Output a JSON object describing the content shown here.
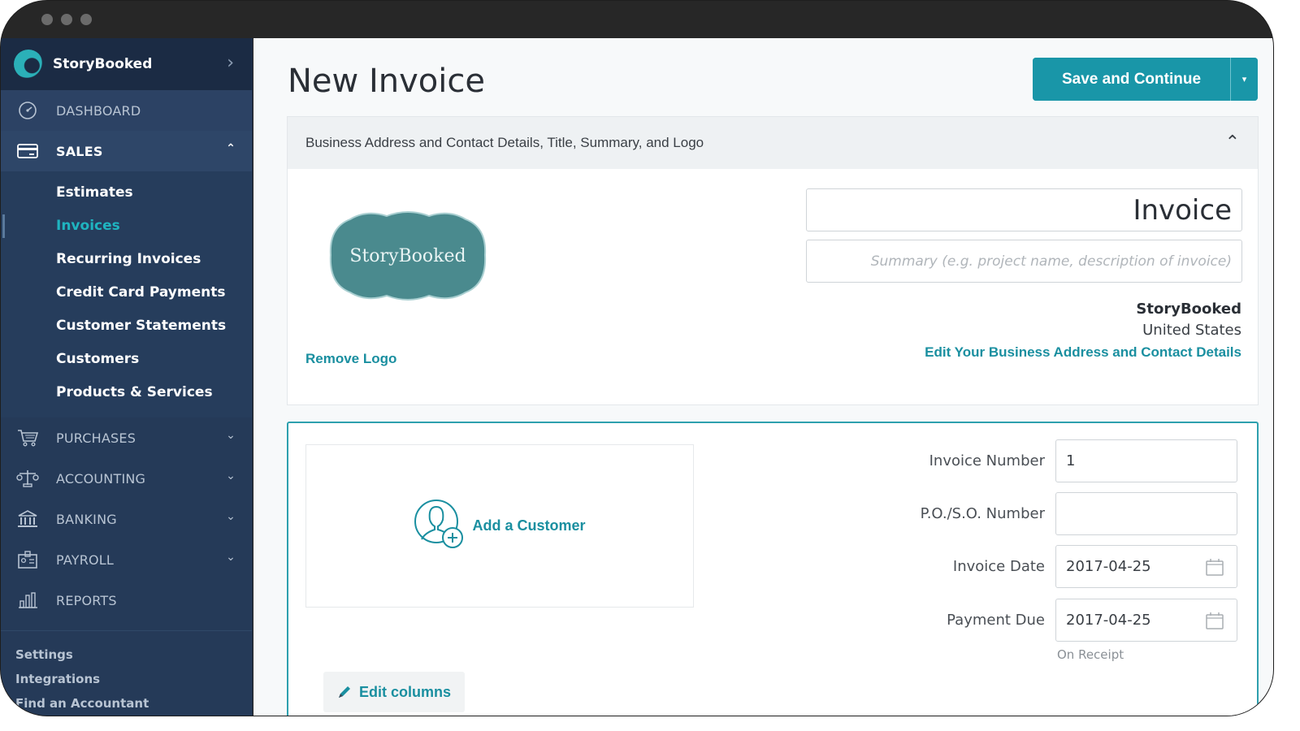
{
  "window": {
    "controls": [
      "close",
      "minimize",
      "maximize"
    ]
  },
  "sidebar": {
    "brand": {
      "name": "StoryBooked",
      "icon": "brand-logo-icon",
      "chevron": "›"
    },
    "nav": [
      {
        "label": "DASHBOARD",
        "icon": "dashboard-gauge-icon",
        "expanded": null
      },
      {
        "label": "SALES",
        "icon": "credit-card-icon",
        "expanded": true,
        "chevron": "^"
      },
      {
        "label": "PURCHASES",
        "icon": "shopping-cart-icon",
        "expanded": false,
        "chevron": "v"
      },
      {
        "label": "ACCOUNTING",
        "icon": "scales-icon",
        "expanded": false,
        "chevron": "v"
      },
      {
        "label": "BANKING",
        "icon": "bank-icon",
        "expanded": false,
        "chevron": "v"
      },
      {
        "label": "PAYROLL",
        "icon": "id-badge-icon",
        "expanded": false,
        "chevron": "v"
      },
      {
        "label": "REPORTS",
        "icon": "bar-chart-icon",
        "expanded": null
      }
    ],
    "sales_items": [
      {
        "label": "Estimates",
        "active": false
      },
      {
        "label": "Invoices",
        "active": true
      },
      {
        "label": "Recurring Invoices",
        "active": false
      },
      {
        "label": "Credit Card Payments",
        "active": false
      },
      {
        "label": "Customer Statements",
        "active": false
      },
      {
        "label": "Customers",
        "active": false
      },
      {
        "label": "Products & Services",
        "active": false
      }
    ],
    "footer": [
      "Settings",
      "Integrations",
      "Find an Accountant"
    ]
  },
  "header": {
    "title": "New Invoice",
    "save_label": "Save and Continue",
    "save_caret": "▾"
  },
  "business_panel": {
    "heading": "Business Address and Contact Details, Title, Summary, and Logo",
    "collapse_glyph": "^",
    "logo_text": "StoryBooked",
    "remove_logo": "Remove Logo",
    "title_value": "Invoice",
    "summary_value": "",
    "summary_placeholder": "Summary (e.g. project name, description of invoice)",
    "business_name": "StoryBooked",
    "business_country": "United States",
    "edit_link": "Edit Your Business Address and Contact Details"
  },
  "invoice_panel": {
    "add_customer": "Add a Customer",
    "fields": [
      {
        "label": "Invoice Number",
        "value": "1"
      },
      {
        "label": "P.O./S.O. Number",
        "value": ""
      },
      {
        "label": "Invoice Date",
        "value": "2017-04-25"
      },
      {
        "label": "Payment Due",
        "value": "2017-04-25"
      }
    ],
    "payment_due_note": "On Receipt",
    "edit_columns": "Edit columns"
  },
  "colors": {
    "accent": "#1996a8",
    "link": "#1a8fa0",
    "sidebar_bg": "#253a58",
    "sidebar_active_text": "#1fb4c0",
    "logo_cloud": "#4a8a8e"
  }
}
